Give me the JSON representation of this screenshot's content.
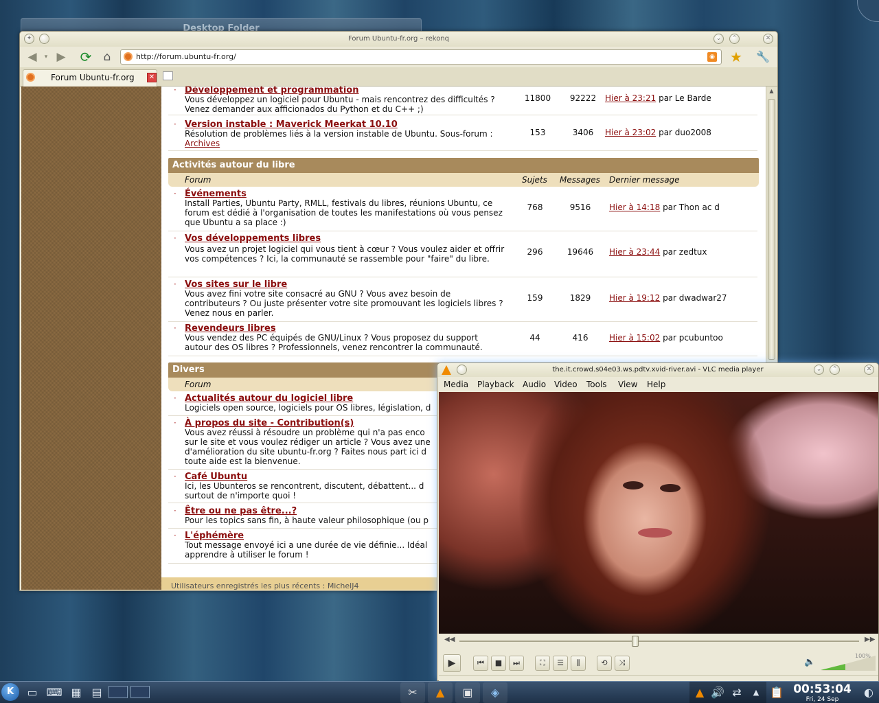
{
  "desktop": {
    "folder_title": "Desktop Folder"
  },
  "browser": {
    "title": "Forum Ubuntu-fr.org – rekonq",
    "url": "http://forum.ubuntu-fr.org/",
    "tab_label": "Forum Ubuntu-fr.org",
    "footer_text": "Utilisateurs enregistrés les plus récents : MichelJ4"
  },
  "forum": {
    "top_rows": [
      {
        "name": "Développement et programmation",
        "desc": "Vous développez un logiciel pour Ubuntu - mais rencontrez des difficultés ? Venez demander aux afficionados du Python et du C++ ;)",
        "topics": "11800",
        "posts": "92222",
        "last_link": "Hier à 23:21",
        "last_by": "par Le Barde"
      },
      {
        "name": "Version instable : Maverick Meerkat 10.10",
        "desc": "Résolution de problèmes liés à la version instable de Ubuntu. Sous-forum :",
        "desc_link": "Archives",
        "topics": "153",
        "posts": "3406",
        "last_link": "Hier à 23:02",
        "last_by": "par duo2008"
      }
    ],
    "cat1": {
      "title": "Activités autour du libre",
      "col_forum": "Forum",
      "col_topics": "Sujets",
      "col_posts": "Messages",
      "col_last": "Dernier message",
      "rows": [
        {
          "name": "Événements",
          "desc": "Install Parties, Ubuntu Party, RMLL, festivals du libres, réunions Ubuntu, ce forum est dédié à l'organisation de toutes les manifestations où vous pensez que Ubuntu a sa place :)",
          "topics": "768",
          "posts": "9516",
          "last_link": "Hier à 14:18",
          "last_by": "par Thon ac d"
        },
        {
          "name": "Vos développements libres",
          "desc": "Vous avez un projet logiciel qui vous tient à cœur ? Vous voulez aider et offrir vos compétences ? Ici, la communauté se rassemble pour \"faire\" du libre.",
          "topics": "296",
          "posts": "19646",
          "last_link": "Hier à 23:44",
          "last_by": "par zedtux"
        },
        {
          "name": "Vos sites sur le libre",
          "desc": "Vous avez fini votre site consacré au GNU ? Vous avez besoin de contributeurs ? Ou juste présenter votre site promouvant les logiciels libres ? Venez nous en parler.",
          "topics": "159",
          "posts": "1829",
          "last_link": "Hier à 19:12",
          "last_by": "par dwadwar27"
        },
        {
          "name": "Revendeurs libres",
          "desc": "Vous vendez des PC équipés de GNU/Linux ? Vous proposez du support autour des OS libres ? Professionnels, venez rencontrer la communauté.",
          "topics": "44",
          "posts": "416",
          "last_link": "Hier à 15:02",
          "last_by": "par pcubuntoo"
        }
      ]
    },
    "cat2": {
      "title": "Divers",
      "col_forum": "Forum",
      "rows": [
        {
          "name": "Actualités autour du logiciel libre",
          "desc": "Logiciels open source, logiciels pour OS libres, législation, d"
        },
        {
          "name": "À propos du site - Contribution(s)",
          "desc": "Vous avez réussi à résoudre un problème qui n'a pas enco sur le site et vous voulez rédiger un article ? Vous avez une d'amélioration du site ubuntu-fr.org ? Faites nous part ici d toute aide est la bienvenue."
        },
        {
          "name": "Café Ubuntu",
          "desc": "Ici, les Ubunteros se rencontrent, discutent, débattent... d surtout de n'importe quoi !"
        },
        {
          "name": "Être ou ne pas être...?",
          "desc": "Pour les topics sans fin, à haute valeur philosophique (ou p"
        },
        {
          "name": "L'éphémère",
          "desc": "Tout message envoyé ici a une durée de vie définie... Idéal apprendre à utiliser le forum !"
        }
      ]
    }
  },
  "vlc": {
    "title": "the.it.crowd.s04e03.ws.pdtv.xvid-river.avi - VLC media player",
    "menu": [
      "Media",
      "Playback",
      "Audio",
      "Video",
      "Tools",
      "View",
      "Help"
    ],
    "volume_label": "100%",
    "volume_level": 1.0,
    "seek_position": 0.44
  },
  "taskbar": {
    "time": "00:53:04",
    "date": "Fri, 24 Sep"
  },
  "colors": {
    "link": "#8b0e0e",
    "category": "#a88a5c",
    "sidebar": "#8a6a42",
    "vlc_volume": "#62b93e"
  }
}
